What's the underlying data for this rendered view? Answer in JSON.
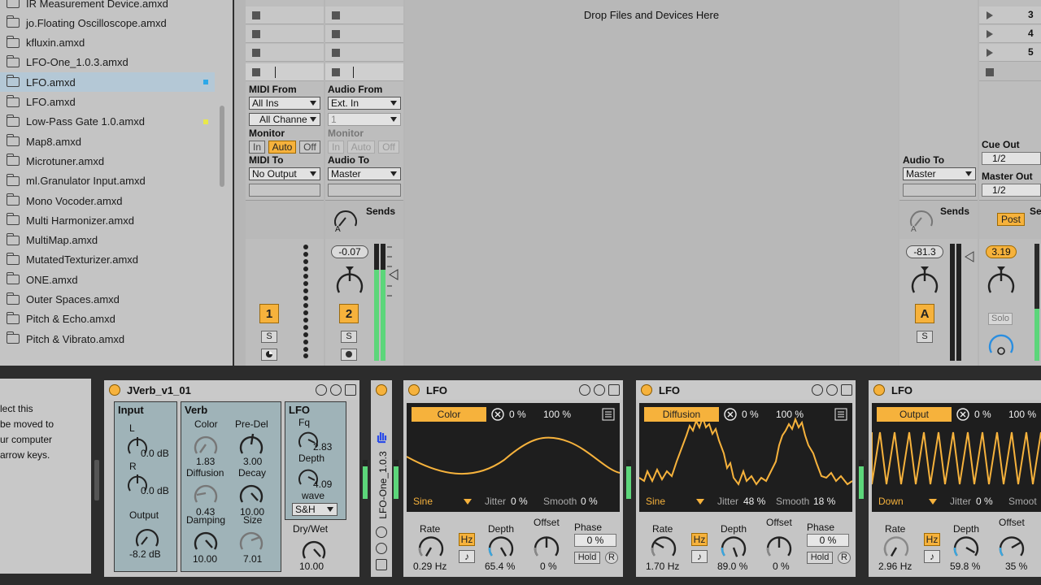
{
  "browser": {
    "items": [
      {
        "label": "IR Measurement Device.amxd"
      },
      {
        "label": "jo.Floating Oscilloscope.amxd"
      },
      {
        "label": "kfluxin.amxd"
      },
      {
        "label": "LFO-One_1.0.3.amxd"
      },
      {
        "label": "LFO.amxd",
        "selected": true,
        "dot": "#2da8e8"
      },
      {
        "label": "LFO.amxd"
      },
      {
        "label": "Low-Pass Gate 1.0.amxd",
        "dot": "#e8e84a"
      },
      {
        "label": "Map8.amxd"
      },
      {
        "label": "Microtuner.amxd"
      },
      {
        "label": "ml.Granulator Input.amxd"
      },
      {
        "label": "Mono Vocoder.amxd"
      },
      {
        "label": "Multi Harmonizer.amxd"
      },
      {
        "label": "MultiMap.amxd"
      },
      {
        "label": "MutatedTexturizer.amxd"
      },
      {
        "label": "ONE.amxd"
      },
      {
        "label": "Outer Spaces.amxd"
      },
      {
        "label": "Pitch & Echo.amxd"
      },
      {
        "label": "Pitch & Vibrato.amxd"
      }
    ]
  },
  "session": {
    "drop_text": "Drop Files and Devices Here",
    "scene_numbers": [
      "3",
      "4",
      "5"
    ],
    "track1": {
      "io_from_label": "MIDI From",
      "from": "All Ins",
      "channel": "All Channe",
      "monitor_label": "Monitor",
      "monitor": [
        "In",
        "Auto",
        "Off"
      ],
      "to_label": "MIDI To",
      "to": "No Output",
      "number": "1",
      "solo": "S"
    },
    "track2": {
      "io_from_label": "Audio From",
      "from": "Ext. In",
      "channel": "1",
      "monitor_label": "Monitor",
      "monitor": [
        "In",
        "Auto",
        "Off"
      ],
      "to_label": "Audio To",
      "to": "Master",
      "sends_label": "Sends",
      "send_letter": "A",
      "volume": "-0.07",
      "number": "2",
      "solo": "S"
    },
    "return": {
      "to_label": "Audio To",
      "to": "Master",
      "sends_label": "Sends",
      "send_letter": "A",
      "volume": "-81.3",
      "letter": "A",
      "solo": "S"
    },
    "master": {
      "cue_label": "Cue Out",
      "cue": "1/2",
      "master_label": "Master Out",
      "master": "1/2",
      "post": "Post",
      "sends_label": "Se",
      "volume": "3.19",
      "solo": "Solo"
    }
  },
  "hint": {
    "lines": [
      "lect this",
      "be moved to",
      "ur computer",
      "arrow keys."
    ]
  },
  "jverb": {
    "title": "JVerb_v1_01",
    "input": {
      "label": "Input",
      "l": "L",
      "l_val": "0.0 dB",
      "r": "R",
      "r_val": "0.0 dB",
      "out_label": "Output",
      "out_val": "-8.2 dB"
    },
    "verb": {
      "label": "Verb",
      "color": "Color",
      "color_val": "1.83",
      "predel": "Pre-Del",
      "predel_val": "3.00",
      "diff": "Diffusion",
      "diff_val": "0.43",
      "decay": "Decay",
      "decay_val": "10.00",
      "damp": "Damping",
      "damp_val": "10.00",
      "size": "Size",
      "size_val": "7.01"
    },
    "lfo": {
      "label": "LFO",
      "fq": "Fq",
      "fq_val": "2.83",
      "depth": "Depth",
      "depth_val": "4.09",
      "wave": "wave",
      "wave_sel": "S&H",
      "drywet": "Dry/Wet",
      "drywet_val": "10.00"
    }
  },
  "lfo_one": {
    "title": "LFO-One_1.0.3"
  },
  "lfos": [
    {
      "title": "LFO",
      "target": "Color",
      "min": "0 %",
      "max": "100 %",
      "shape": "Sine",
      "jitter_label": "Jitter",
      "jitter": "0 %",
      "smooth_label": "Smooth",
      "smooth": "0 %",
      "rate_label": "Rate",
      "rate": "0.29 Hz",
      "hz": "Hz",
      "depth_label": "Depth",
      "depth": "65.4 %",
      "offset_label": "Offset",
      "offset": "0 %",
      "phase_label": "Phase",
      "phase": "0 %",
      "hold": "Hold",
      "r": "R"
    },
    {
      "title": "LFO",
      "target": "Diffusion",
      "min": "0 %",
      "max": "100 %",
      "shape": "Sine",
      "jitter_label": "Jitter",
      "jitter": "48 %",
      "smooth_label": "Smooth",
      "smooth": "18 %",
      "rate_label": "Rate",
      "rate": "1.70 Hz",
      "hz": "Hz",
      "depth_label": "Depth",
      "depth": "89.0 %",
      "offset_label": "Offset",
      "offset": "0 %",
      "phase_label": "Phase",
      "phase": "0 %",
      "hold": "Hold",
      "r": "R"
    },
    {
      "title": "LFO",
      "target": "Output",
      "min": "0 %",
      "max": "100 %",
      "shape": "Down",
      "jitter_label": "Jitter",
      "jitter": "0 %",
      "smooth_label": "Smoot",
      "smooth": "",
      "rate_label": "Rate",
      "rate": "2.96 Hz",
      "hz": "Hz",
      "depth_label": "Depth",
      "depth": "59.8 %",
      "offset_label": "Offset",
      "offset": "35 %",
      "phase_label": "",
      "phase": "",
      "hold": "",
      "r": ""
    }
  ]
}
